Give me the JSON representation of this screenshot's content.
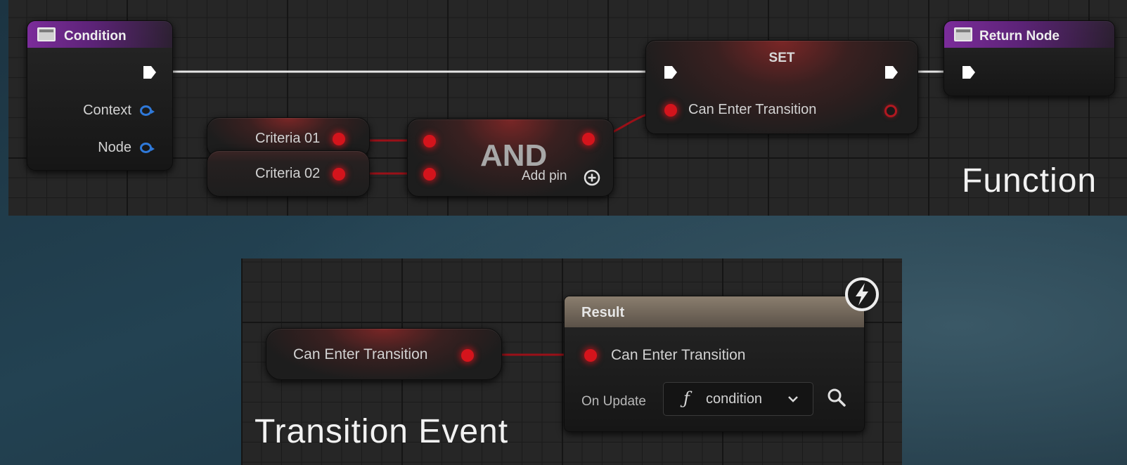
{
  "sections": {
    "function_label": "Function",
    "transition_label": "Transition Event"
  },
  "condition_node": {
    "title": "Condition",
    "pins": [
      "Context",
      "Node"
    ]
  },
  "criteria_nodes": [
    "Criteria 01",
    "Criteria 02"
  ],
  "and_node": {
    "title": "AND",
    "add_pin_label": "Add pin"
  },
  "set_node": {
    "title": "SET",
    "pin_label": "Can Enter Transition"
  },
  "return_node": {
    "title": "Return Node"
  },
  "getter_node": {
    "label": "Can Enter Transition"
  },
  "result_node": {
    "title": "Result",
    "pin_label": "Can Enter Transition",
    "on_update_label": "On Update",
    "function_value": "condition",
    "function_glyph": "ƒ"
  },
  "colors": {
    "event_purple": "#7b2c9a",
    "bool_pin_red": "#d4141c",
    "object_pin_blue": "#2f79d9",
    "exec_white": "#ffffff"
  },
  "icons": [
    "function-icon",
    "exec-pin-icon",
    "add-pin-icon",
    "search-icon",
    "chevron-down-icon",
    "lightning-icon"
  ]
}
